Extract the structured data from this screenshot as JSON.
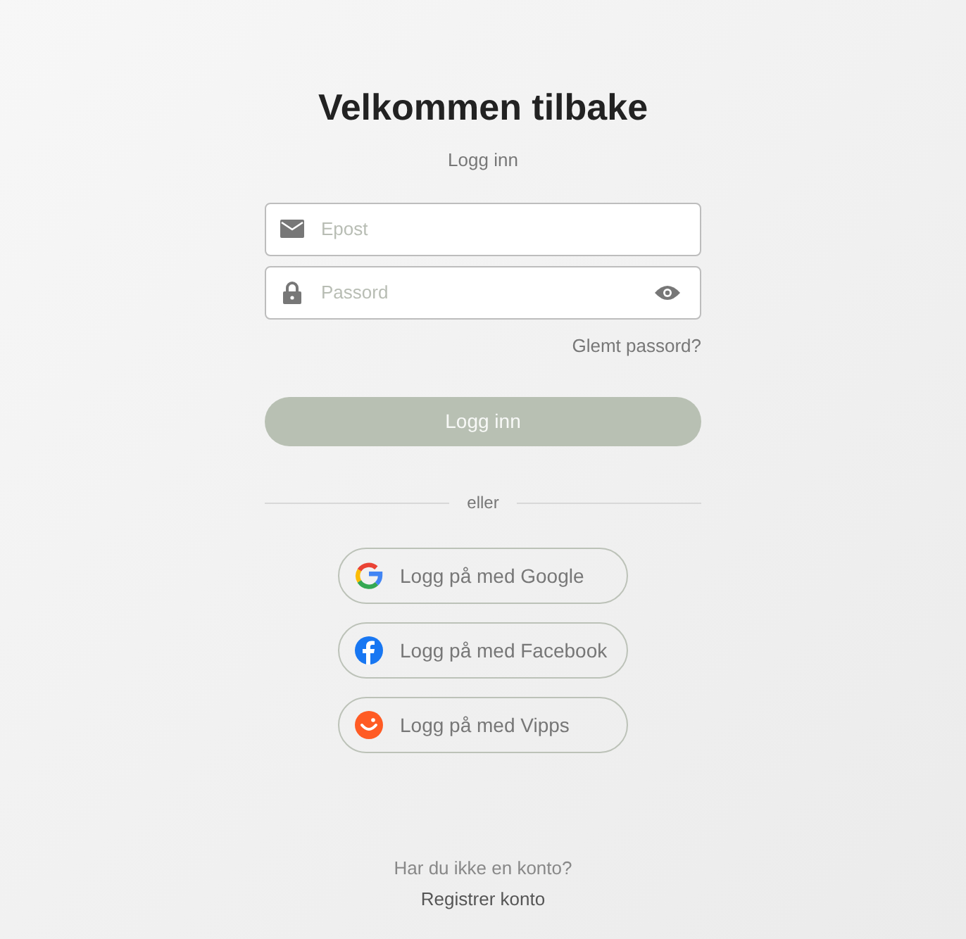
{
  "title": "Velkommen tilbake",
  "subtitle": "Logg inn",
  "fields": [
    {
      "kind": "email",
      "placeholder": "Epost"
    },
    {
      "kind": "password",
      "placeholder": "Passord"
    }
  ],
  "forgot_link": "Glemt passord?",
  "login_button": {
    "label": "Logg inn",
    "disabled": true
  },
  "divider": "eller",
  "social_buttons": [
    {
      "kind": "google",
      "label": "Logg på med Google"
    },
    {
      "kind": "facebook",
      "label": "Logg på med Facebook"
    },
    {
      "kind": "vipps",
      "label": "Logg på med Vipps"
    }
  ],
  "footer": {
    "prompt": "Har du ikke en konto?",
    "link": "Registrer konto"
  }
}
